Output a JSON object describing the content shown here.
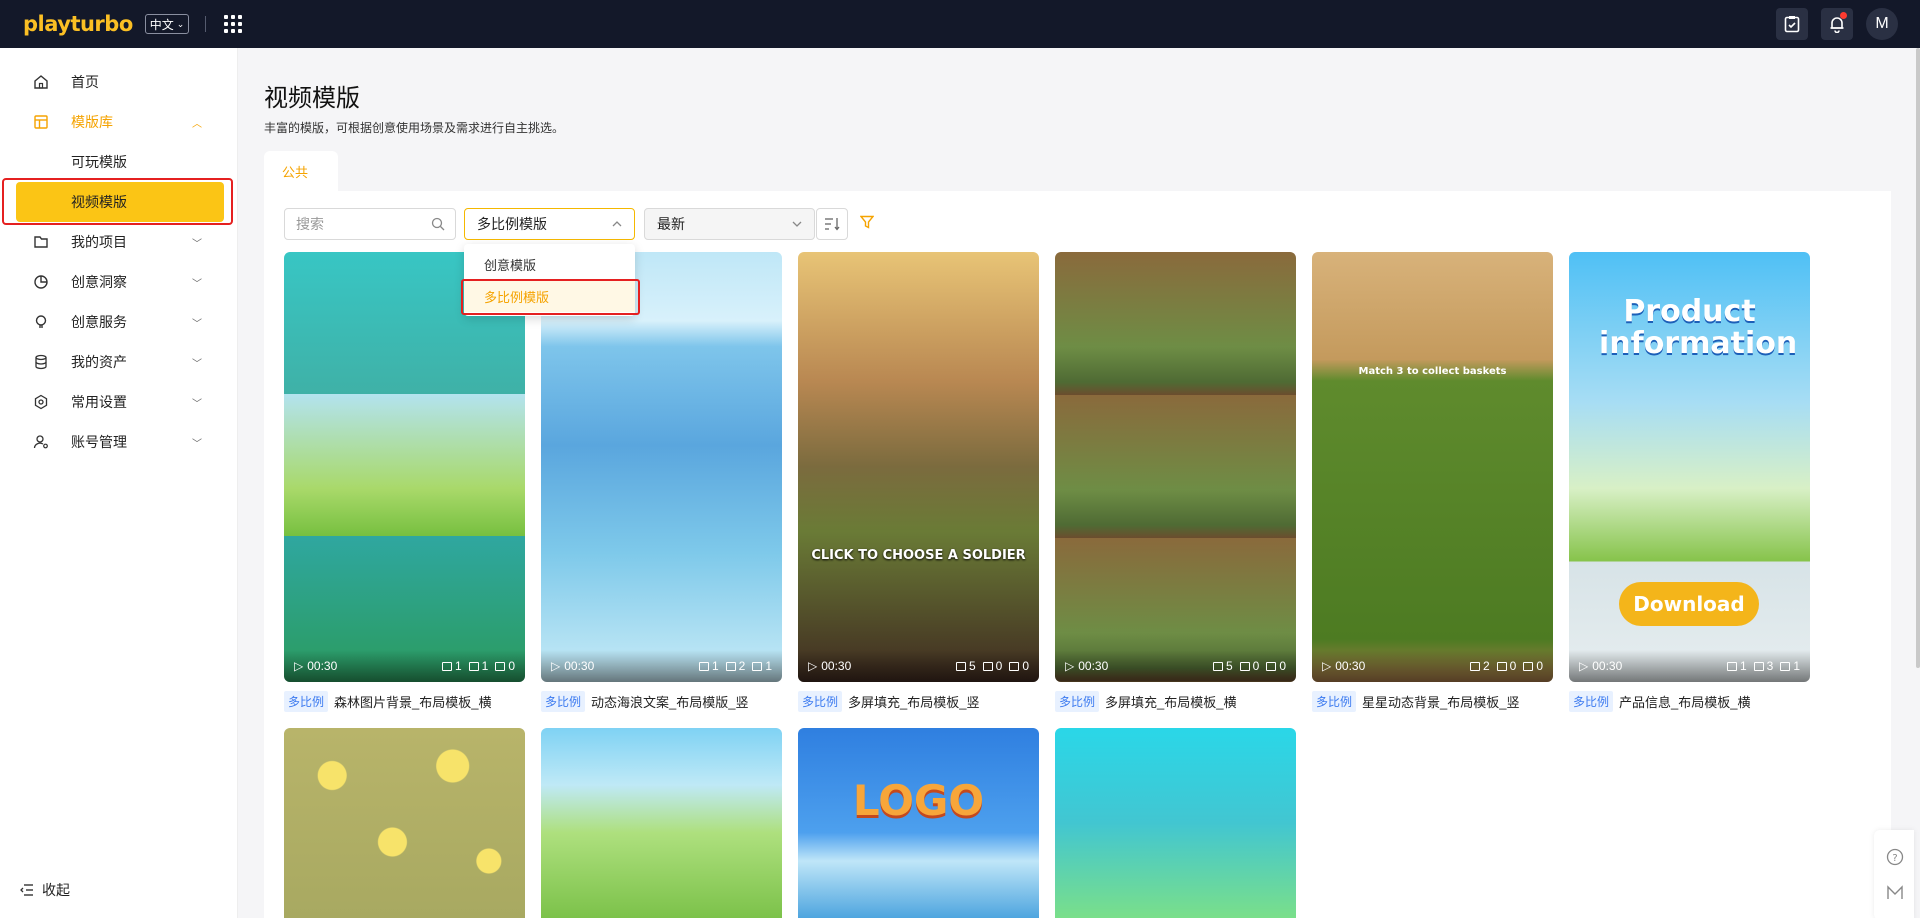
{
  "header": {
    "logo_text": "playturbo",
    "language": "中文",
    "avatar_initial": "M"
  },
  "sidebar": {
    "items": [
      {
        "label": "首页",
        "icon": "home-icon"
      },
      {
        "label": "模版库",
        "icon": "layout-icon"
      },
      {
        "label": "我的项目",
        "icon": "folder-icon"
      },
      {
        "label": "创意洞察",
        "icon": "pie-chart-icon"
      },
      {
        "label": "创意服务",
        "icon": "lightbulb-icon"
      },
      {
        "label": "我的资产",
        "icon": "database-icon"
      },
      {
        "label": "常用设置",
        "icon": "settings-icon"
      },
      {
        "label": "账号管理",
        "icon": "user-settings-icon"
      }
    ],
    "sub_items": [
      "可玩模版",
      "视频模版"
    ],
    "collapse_label": "收起"
  },
  "page": {
    "title": "视频模版",
    "subtitle": "丰富的模版，可根据创意使用场景及需求进行自主挑选。",
    "tab": "公共"
  },
  "filters": {
    "search_placeholder": "搜索",
    "template_select": "多比例模版",
    "sort_select": "最新",
    "dropdown_options": [
      "创意模版",
      "多比例模版"
    ]
  },
  "cards": [
    {
      "tag": "多比例",
      "title": "森林图片背景_布局模板_横",
      "duration": "00:30",
      "counts": [
        "1",
        "1",
        "0"
      ]
    },
    {
      "tag": "多比例",
      "title": "动态海浪文案_布局模版_竖",
      "duration": "00:30",
      "counts": [
        "1",
        "2",
        "1"
      ]
    },
    {
      "tag": "多比例",
      "title": "多屏填充_布局模板_竖",
      "duration": "00:30",
      "counts": [
        "5",
        "0",
        "0"
      ],
      "overlay": "CLICK TO CHOOSE A SOLDIER"
    },
    {
      "tag": "多比例",
      "title": "多屏填充_布局模板_横",
      "duration": "00:30",
      "counts": [
        "5",
        "0",
        "0"
      ]
    },
    {
      "tag": "多比例",
      "title": "星星动态背景_布局模板_竖",
      "duration": "00:30",
      "counts": [
        "2",
        "0",
        "0"
      ],
      "overlay": "Match 3 to collect baskets"
    },
    {
      "tag": "多比例",
      "title": "产品信息_布局模板_横",
      "duration": "00:30",
      "counts": [
        "1",
        "3",
        "1"
      ],
      "overlay": "Product information",
      "overlay2": "Download"
    }
  ],
  "row2": [
    {
      "overlay": ""
    },
    {
      "overlay": ""
    },
    {
      "overlay": "LOGO"
    },
    {
      "overlay": ""
    }
  ],
  "colors": {
    "accent": "#fbc515",
    "accent_text": "#f5a300",
    "topbar": "#131829",
    "tag_bg": "#e8f1ff",
    "tag_text": "#3d7bf0",
    "highlight": "#e52020"
  }
}
